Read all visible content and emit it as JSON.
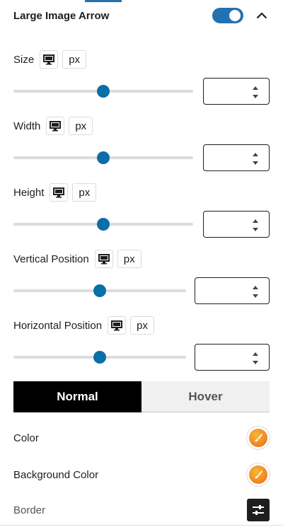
{
  "panel": {
    "title": "Large Image Arrow",
    "toggle_on": true
  },
  "controls": [
    {
      "label": "Size",
      "device_icon": "desktop-icon",
      "unit": "px",
      "value": "",
      "slider_fraction": 0.5
    },
    {
      "label": "Width",
      "device_icon": "desktop-icon",
      "unit": "px",
      "value": "",
      "slider_fraction": 0.5
    },
    {
      "label": "Height",
      "device_icon": "desktop-icon",
      "unit": "px",
      "value": "",
      "slider_fraction": 0.5
    },
    {
      "label": "Vertical Position",
      "device_icon": "desktop-icon",
      "unit": "px",
      "value": "",
      "slider_fraction": 0.5
    },
    {
      "label": "Horizontal Position",
      "device_icon": "desktop-icon",
      "unit": "px",
      "value": "",
      "slider_fraction": 0.5
    }
  ],
  "tabs": [
    {
      "label": "Normal",
      "active": true
    },
    {
      "label": "Hover",
      "active": false
    }
  ],
  "options": {
    "color_label": "Color",
    "background_color_label": "Background Color",
    "border_label": "Border"
  },
  "colors": {
    "accent": "#2271b1",
    "slider_thumb": "#0a6ea8",
    "tab_active_bg": "#000000",
    "tab_inactive_bg": "#f0f0f0"
  }
}
